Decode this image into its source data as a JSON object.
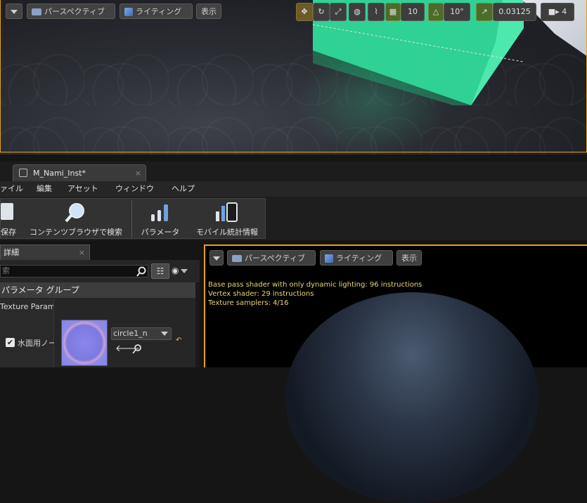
{
  "top_viewport": {
    "perspective_label": "パースペクティブ",
    "lighting_label": "ライティング",
    "show_label": "表示",
    "grid_snap_value": "10",
    "rotation_snap_value": "10°",
    "scale_snap_value": "0.03125",
    "camera_speed_value": "4"
  },
  "document_tab": {
    "label": "M_Nami_Inst*",
    "close": "×"
  },
  "menu": {
    "items": [
      "ァイル",
      "編集",
      "アセット",
      "ウィンドウ",
      "ヘルプ"
    ]
  },
  "toolbar": {
    "save_label": "保存",
    "browse_label": "コンテンツブラウザで検索",
    "params_label": "パラメータ",
    "mobile_stats_label": "モバイル統計情報"
  },
  "details": {
    "tab_label": "詳細",
    "close": "×",
    "search_placeholder": "索",
    "param_group_header": "パラメータ グループ",
    "texture_param_label": "Texture Param",
    "water_normal_label": "水面用ノー",
    "water_normal_checked": true,
    "texture_name": "circle1_n"
  },
  "material_viewport": {
    "perspective_label": "パースペクティブ",
    "lighting_label": "ライティング",
    "show_label": "表示",
    "stats": [
      "Base pass shader with only dynamic lighting: 96 instructions",
      "Vertex shader: 29 instructions",
      "Texture samplers: 4/16"
    ]
  },
  "colors": {
    "viewport_border": "#e3a315",
    "cube_green": "#2fd294",
    "stat_text": "#e8d86a"
  }
}
